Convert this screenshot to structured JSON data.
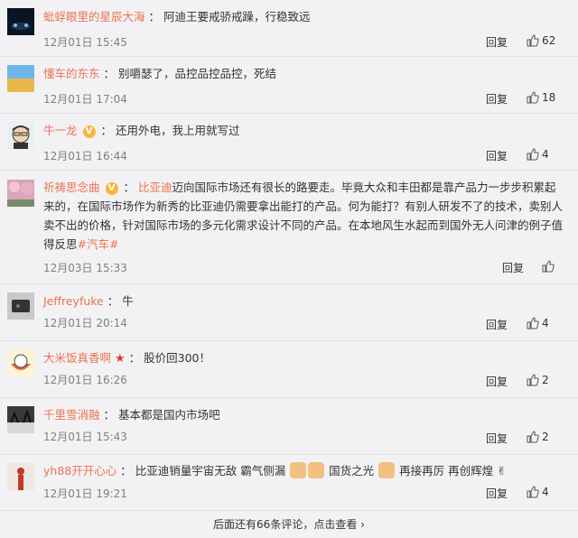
{
  "comments": [
    {
      "name": "蚍蜉眼里的星辰大海",
      "text": "阿迪王要戒骄戒躁，行稳致远",
      "time": "12月01日 15:45",
      "reply": "回复",
      "likes": "62"
    },
    {
      "name": "懂车的东东",
      "text": "别嚼瑟了，品控品控品控，死结",
      "time": "12月01日 17:04",
      "reply": "回复",
      "likes": "18"
    },
    {
      "name": "牛一龙",
      "text": "还用外电，我上用就写过",
      "time": "12月01日 16:44",
      "reply": "回复",
      "likes": "4"
    },
    {
      "name": "祈祷思念曲",
      "mention": "比亚迪",
      "text": "迈向国际市场还有很长的路要走。毕竟大众和丰田都是靠产品力一步步积累起来的，在国际市场作为新秀的比亚迪仍需要拿出能打的产品。何为能打？有别人研发不了的技术，卖别人卖不出的价格，针对国际市场的多元化需求设计不同的产品。在本地风生水起而到国外无人问津的例子值得反思",
      "tag": "#汽车#",
      "time": "12月03日 15:33",
      "reply": "回复",
      "likes": ""
    },
    {
      "name": "Jeffreyfuke",
      "text": "牛",
      "time": "12月01日 20:14",
      "reply": "回复",
      "likes": "4"
    },
    {
      "name": "大米饭真香啊",
      "text": "股价回300！",
      "time": "12月01日 16:26",
      "reply": "回复",
      "likes": "2"
    },
    {
      "name": "千里雪消融",
      "text": "基本都是国内市场吧",
      "time": "12月01日 15:43",
      "reply": "回复",
      "likes": "2"
    },
    {
      "name": "yh88开开心心",
      "text_a": "比亚迪销量宇宙无敌 霸气侧漏",
      "text_b": "国货之光",
      "text_c": "再接再厉 再创辉煌",
      "time": "12月01日 19:21",
      "reply": "回复",
      "likes": "4"
    }
  ],
  "footer": {
    "more": "后面还有66条评论，点击查看 ›"
  },
  "colors": {
    "name": "#eb7350",
    "background": "#f2f2f5"
  }
}
